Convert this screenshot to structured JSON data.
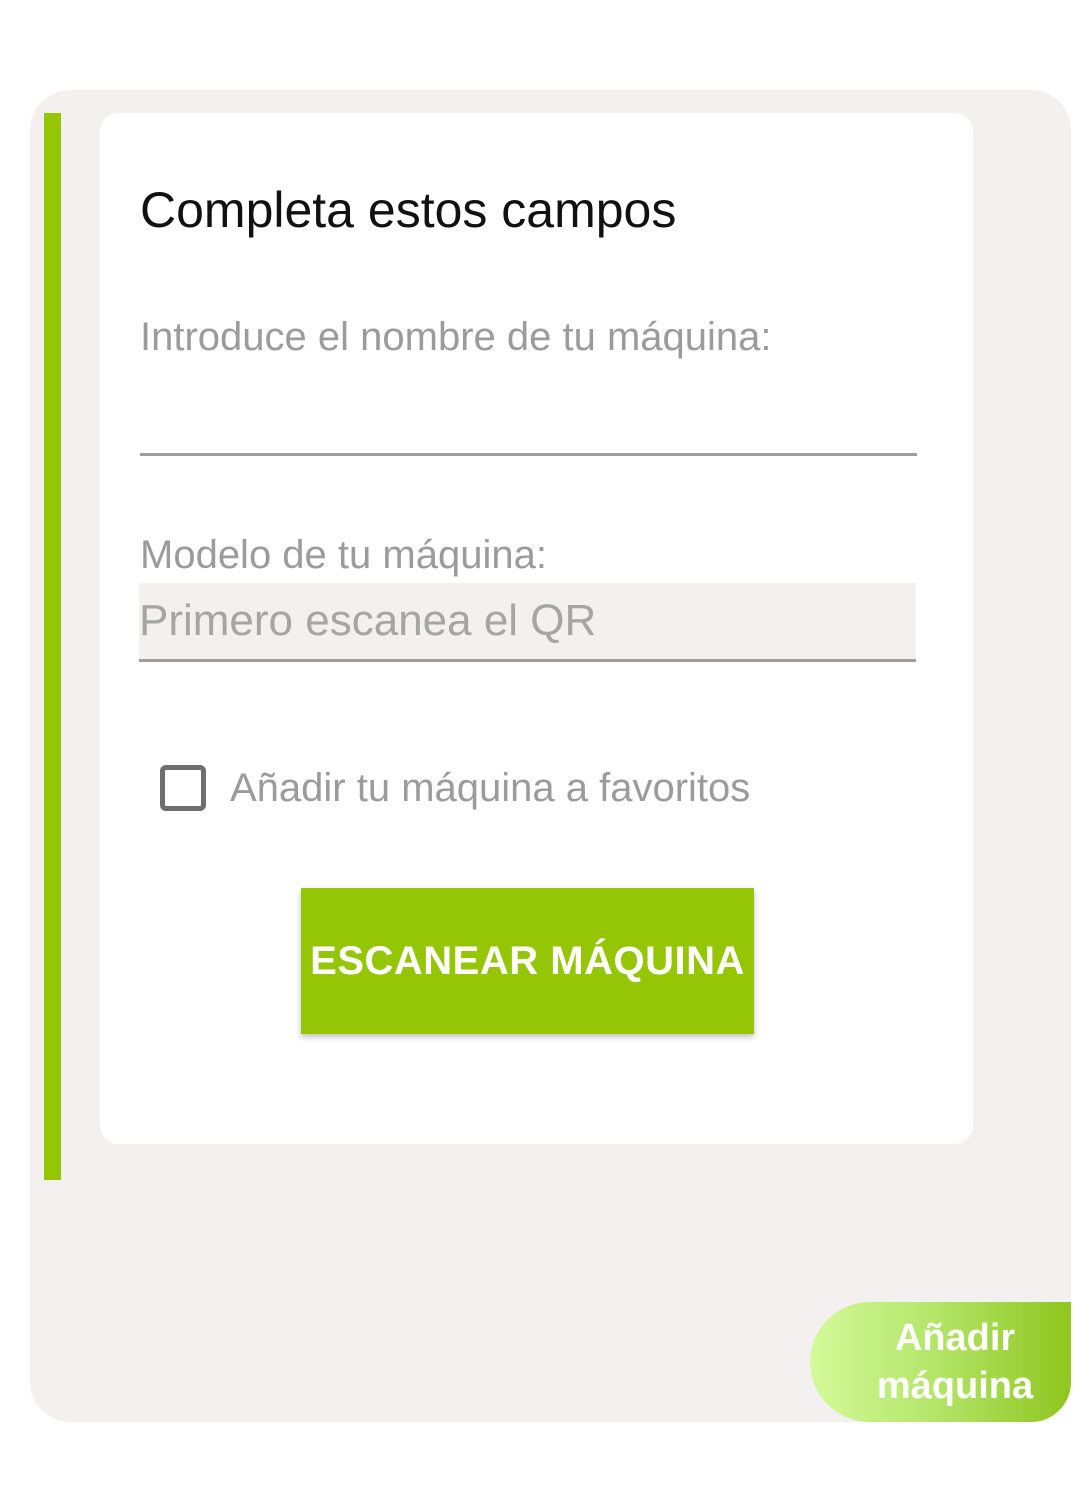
{
  "card": {
    "title": "Completa estos campos",
    "name_label": "Introduce el nombre de tu máquina:",
    "name_value": "",
    "model_label": "Modelo de tu máquina:",
    "model_placeholder": "Primero escanea el QR",
    "favorite_label": "Añadir tu máquina a favoritos",
    "favorite_checked": false,
    "scan_button_label": "ESCANEAR MÁQUINA"
  },
  "floating_button": {
    "line1": "Añadir",
    "line2": "máquina"
  },
  "colors": {
    "accent": "#94c605",
    "panel_background": "#f3f0ef",
    "card_background": "#ffffff",
    "muted_text": "#9b9b9b"
  }
}
